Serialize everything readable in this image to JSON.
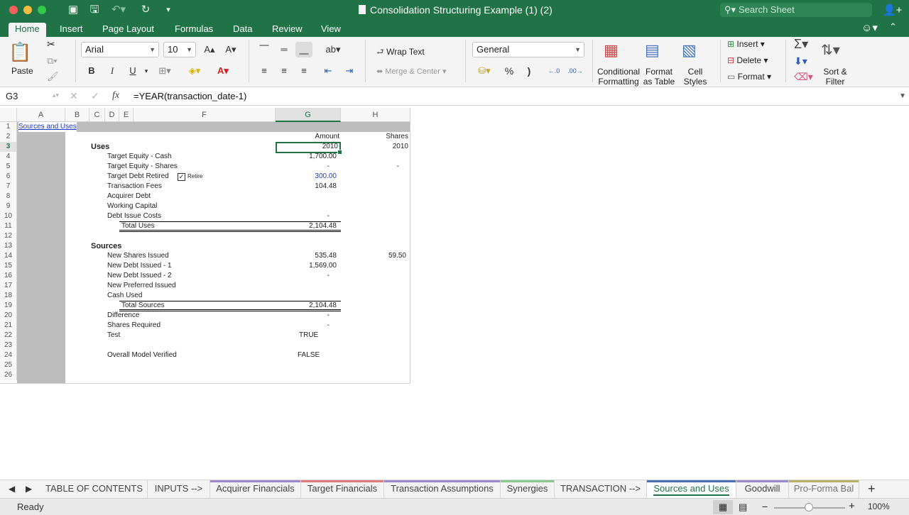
{
  "window": {
    "title": "Consolidation Structuring Example (1) (2)"
  },
  "search": {
    "placeholder": "Search Sheet"
  },
  "ribbon_tabs": [
    "Home",
    "Insert",
    "Page Layout",
    "Formulas",
    "Data",
    "Review",
    "View"
  ],
  "ribbon": {
    "paste": "Paste",
    "font_name": "Arial",
    "font_size": "10",
    "bold": "B",
    "italic": "I",
    "underline": "U",
    "wrap_text": "Wrap Text",
    "merge_center": "Merge & Center",
    "number_format": "General",
    "percent": "%",
    "comma": ")",
    "conditional_formatting": [
      "Conditional",
      "Formatting"
    ],
    "format_as_table": [
      "Format",
      "as Table"
    ],
    "cell_styles": [
      "Cell",
      "Styles"
    ],
    "insert": "Insert",
    "delete": "Delete",
    "format": "Format",
    "sort_filter": [
      "Sort &",
      "Filter"
    ]
  },
  "formula_bar": {
    "name_box": "G3",
    "formula": "=YEAR(transaction_date-1)"
  },
  "columns": [
    "A",
    "B",
    "C",
    "D",
    "E",
    "F",
    "G",
    "H"
  ],
  "rows": [
    "1",
    "2",
    "3",
    "4",
    "5",
    "6",
    "7",
    "8",
    "9",
    "10",
    "11",
    "12",
    "13",
    "14",
    "15",
    "16",
    "17",
    "18",
    "19",
    "20",
    "21",
    "22",
    "23",
    "24",
    "25",
    "26"
  ],
  "sheet": {
    "link": "Sources and Uses",
    "hdr_amount": "Amount",
    "hdr_shares": "Shares",
    "uses_title": "Uses",
    "g3": "2010",
    "h3": "2010",
    "uses": [
      {
        "label": "Target Equity - Cash",
        "g": "1,700.00",
        "h": ""
      },
      {
        "label": "Target Equity - Shares",
        "g": "-",
        "h": "-"
      },
      {
        "label": "Target Debt Retired",
        "g": "300.00",
        "h": ""
      },
      {
        "label": "Transaction Fees",
        "g": "104.48",
        "h": ""
      },
      {
        "label": "Acquirer Debt",
        "g": "",
        "h": ""
      },
      {
        "label": "Working Capital",
        "g": "",
        "h": ""
      },
      {
        "label": "Debt Issue Costs",
        "g": "-",
        "h": ""
      }
    ],
    "retire_label": "Retire",
    "total_uses_label": "Total Uses",
    "total_uses": "2,104.48",
    "sources_title": "Sources",
    "sources": [
      {
        "label": "New Shares Issued",
        "g": "535.48",
        "h": "59.50"
      },
      {
        "label": "New Debt Issued - 1",
        "g": "1,569.00",
        "h": ""
      },
      {
        "label": "New Debt Issued - 2",
        "g": "-",
        "h": ""
      },
      {
        "label": "New Preferred Issued",
        "g": "",
        "h": ""
      },
      {
        "label": "Cash Used",
        "g": "",
        "h": ""
      }
    ],
    "total_sources_label": "Total Sources",
    "total_sources": "2,104.48",
    "difference_label": "Difference",
    "difference": "-",
    "shares_required_label": "Shares Required",
    "shares_required": "-",
    "test_label": "Test",
    "test": "TRUE",
    "verified_label": "Overall Model Verified",
    "verified": "FALSE"
  },
  "sheet_tabs": [
    {
      "label": "TABLE OF CONTENTS",
      "color": ""
    },
    {
      "label": "INPUTS -->",
      "color": ""
    },
    {
      "label": "Acquirer Financials",
      "color": "#9b88c9"
    },
    {
      "label": "Target Financials",
      "color": "#e07b7b"
    },
    {
      "label": "Transaction Assumptions",
      "color": "#9b88c9"
    },
    {
      "label": "Synergies",
      "color": "#8cc98c"
    },
    {
      "label": "TRANSACTION -->",
      "color": ""
    },
    {
      "label": "Sources and Uses",
      "color": "#4a6fb0"
    },
    {
      "label": "Goodwill",
      "color": "#9b88c9"
    },
    {
      "label": "Pro-Forma Bal",
      "color": "#b9b36a"
    }
  ],
  "status": {
    "ready": "Ready",
    "zoom": "100%"
  }
}
